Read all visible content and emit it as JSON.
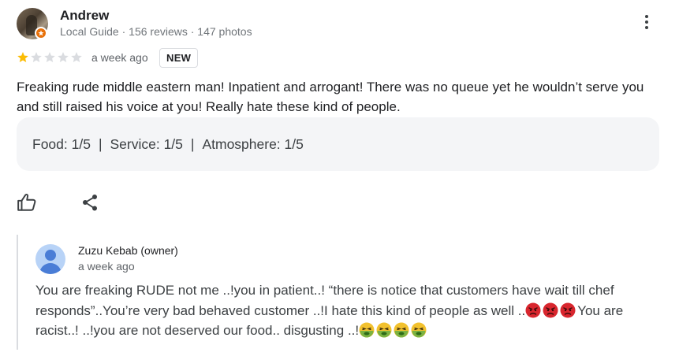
{
  "review": {
    "reviewer_name": "Andrew",
    "reviewer_meta": "Local Guide · 156 reviews · 147 photos",
    "rating": 1,
    "max_rating": 5,
    "time": "a week ago",
    "new_badge": "NEW",
    "text": "Freaking rude middle eastern man! Inpatient and arrogant! There was no queue yet he wouldn’t serve you and still raised his voice at you! Really hate these kind of people.",
    "ratings": {
      "food": "Food: 1/5",
      "service": "Service: 1/5",
      "atmosphere": "Atmosphere: 1/5",
      "separator": "|"
    }
  },
  "actions": {
    "like_icon": "thumbs-up-icon",
    "share_icon": "share-icon",
    "more_icon": "more-vert-icon"
  },
  "owner_reply": {
    "name": "Zuzu Kebab (owner)",
    "time": "a week ago",
    "text_part1": "You are freaking RUDE not me ..!you in patient..! “there is notice that customers have wait till chef responds”..You’re very bad behaved customer ..!I hate this kind of people as well ..",
    "text_part2": "You are racist..! ..!you are not deserved our food.. disgusting ..!",
    "emoji_angry": "angry-face-icon",
    "emoji_nauseated": "nauseated-face-icon"
  },
  "colors": {
    "star_filled": "#fbbc04",
    "star_empty": "#dadce0",
    "badge_orange": "#e8710a",
    "ratings_bg": "#f4f5f7"
  }
}
